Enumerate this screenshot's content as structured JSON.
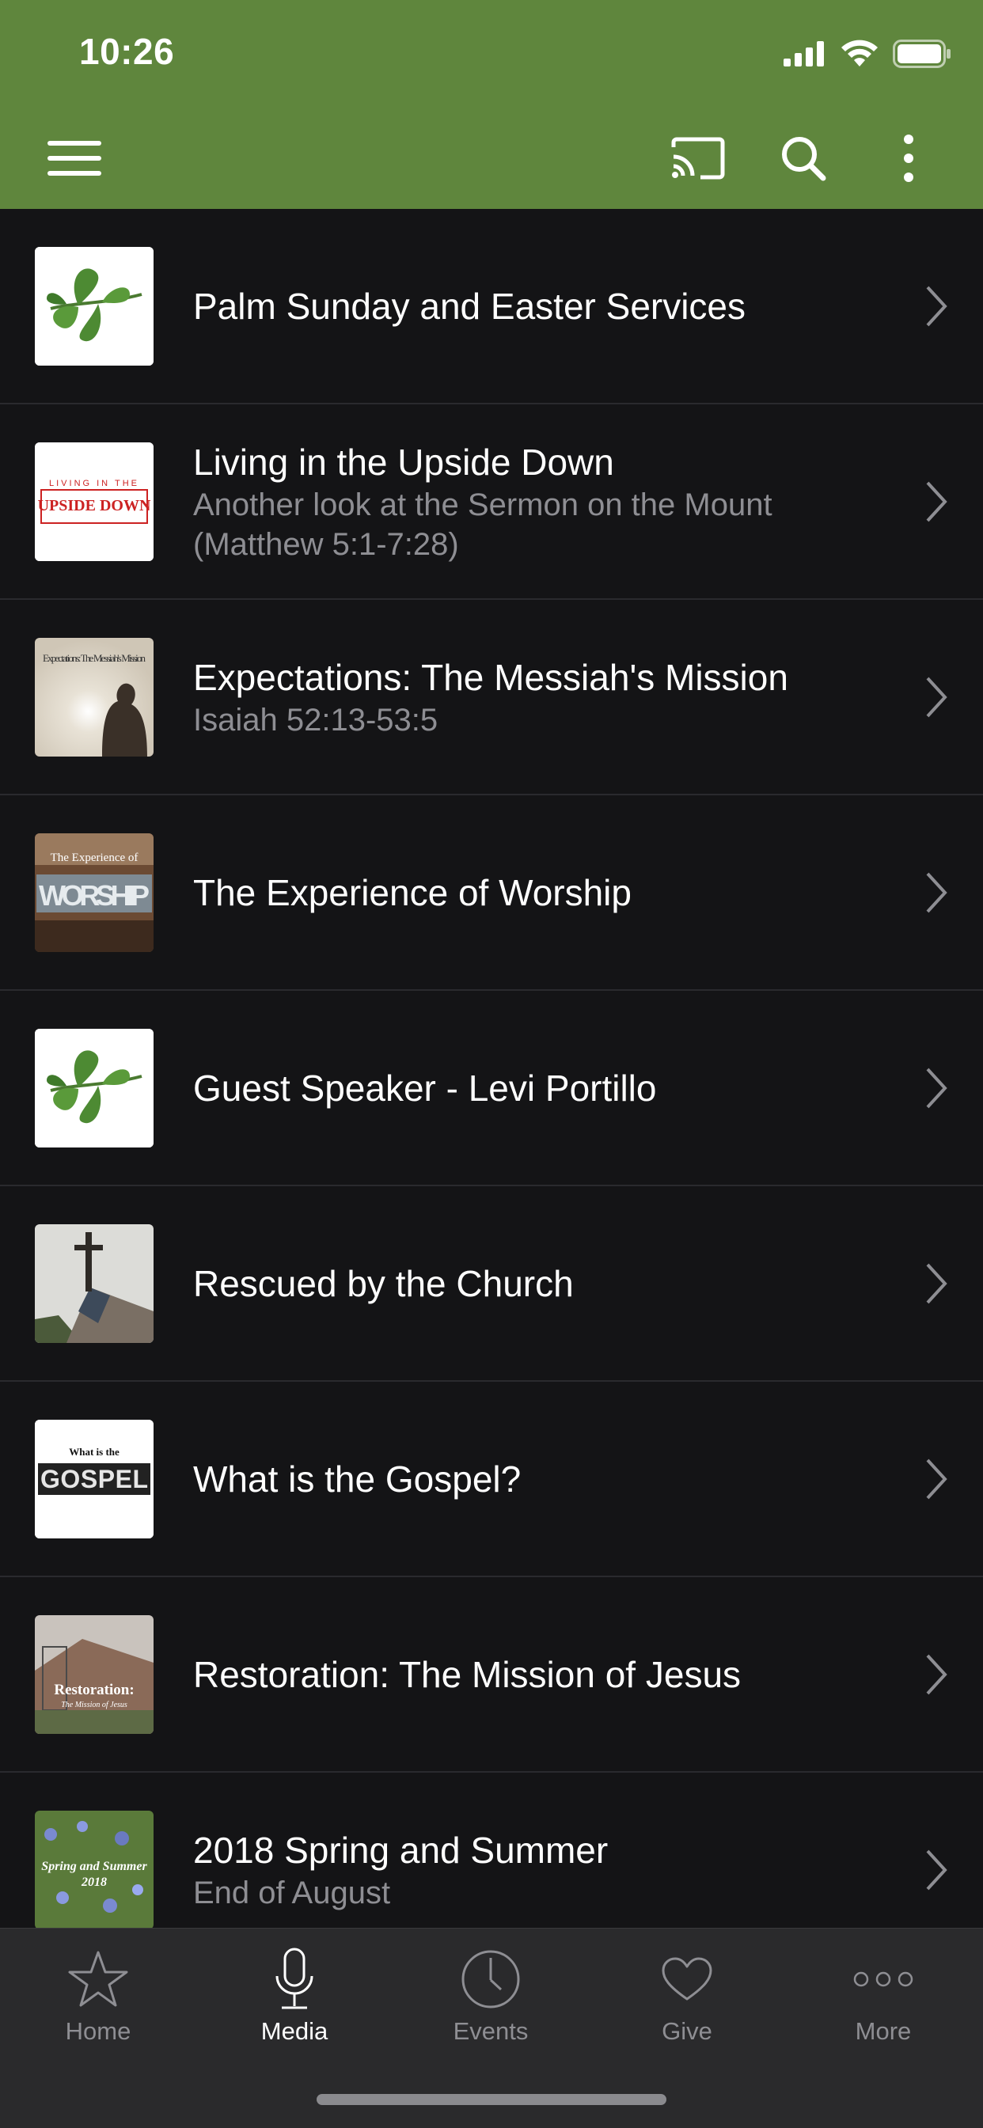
{
  "status": {
    "time": "10:26"
  },
  "header": {
    "menu_icon": "hamburger-icon",
    "cast_icon": "cast-icon",
    "search_icon": "search-icon",
    "more_icon": "kebab-icon",
    "background": "#5f863d"
  },
  "series": [
    {
      "title": "Palm Sunday and Easter Services",
      "subtitle": "",
      "thumb": "leaf"
    },
    {
      "title": "Living in the Upside Down",
      "subtitle": "Another look at the Sermon on the Mount (Matthew 5:1-7:28)",
      "thumb": "upside-down",
      "thumb_text": "UPSIDE DOWN",
      "thumb_caption": "LIVING IN THE"
    },
    {
      "title": "Expectations: The Messiah's Mission",
      "subtitle": "Isaiah 52:13-53:5",
      "thumb": "expectations",
      "thumb_text": "Expectations: The Messiah's Mission"
    },
    {
      "title": "The Experience of Worship",
      "subtitle": "",
      "thumb": "worship",
      "thumb_text": "WORSHIP",
      "thumb_caption": "The Experience of"
    },
    {
      "title": "Guest Speaker - Levi Portillo",
      "subtitle": "",
      "thumb": "leaf"
    },
    {
      "title": "Rescued by the Church",
      "subtitle": "",
      "thumb": "church"
    },
    {
      "title": "What is the Gospel?",
      "subtitle": "",
      "thumb": "gospel",
      "thumb_text": "GOSPEL",
      "thumb_caption": "What is the"
    },
    {
      "title": "Restoration: The Mission of Jesus",
      "subtitle": "",
      "thumb": "restoration",
      "thumb_text": "Restoration:",
      "thumb_caption": "The Mission of Jesus"
    },
    {
      "title": "2018 Spring and Summer",
      "subtitle": "End of August",
      "thumb": "spring",
      "thumb_text": "Spring and Summer",
      "thumb_caption": "2018"
    }
  ],
  "tabs": [
    {
      "label": "Home",
      "icon": "star-icon",
      "active": false
    },
    {
      "label": "Media",
      "icon": "microphone-icon",
      "active": true
    },
    {
      "label": "Events",
      "icon": "clock-icon",
      "active": false
    },
    {
      "label": "Give",
      "icon": "heart-icon",
      "active": false
    },
    {
      "label": "More",
      "icon": "more-dots-icon",
      "active": false
    }
  ]
}
